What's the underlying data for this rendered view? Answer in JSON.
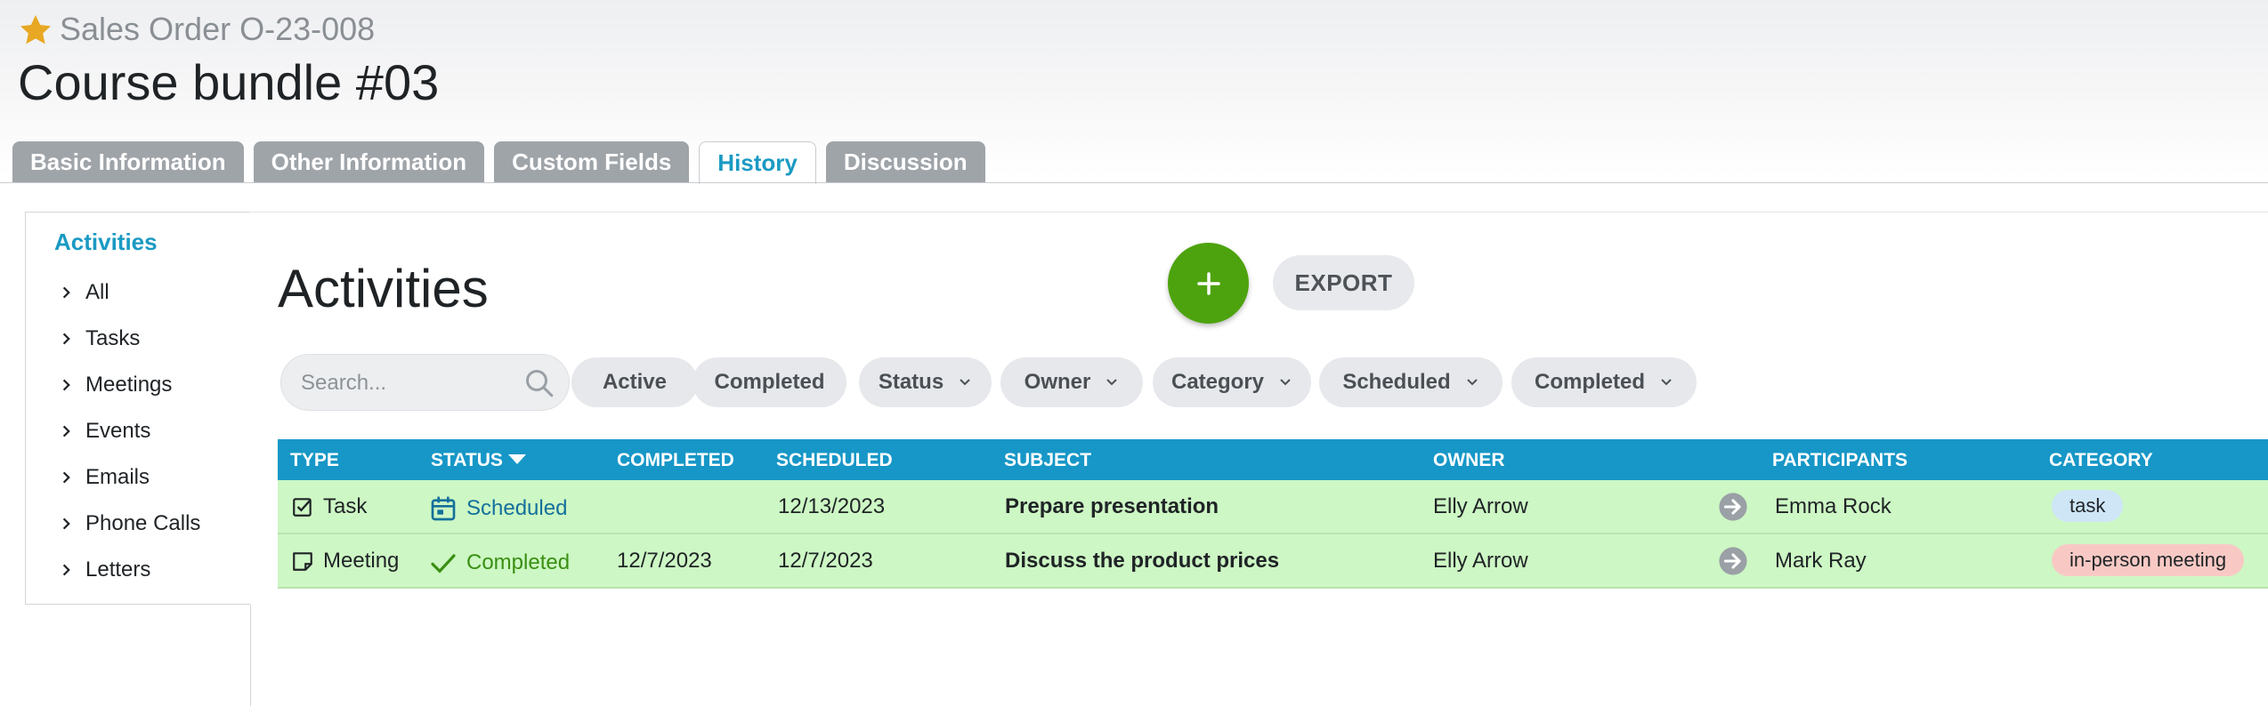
{
  "header": {
    "record_type": "Sales Order",
    "record_number": "O-23-008",
    "title": "Course bundle #03"
  },
  "tabs": [
    {
      "label": "Basic Information",
      "active": false
    },
    {
      "label": "Other Information",
      "active": false
    },
    {
      "label": "Custom Fields",
      "active": false
    },
    {
      "label": "History",
      "active": true
    },
    {
      "label": "Discussion",
      "active": false
    }
  ],
  "sidebar": {
    "title": "Activities",
    "items": [
      {
        "label": "All"
      },
      {
        "label": "Tasks"
      },
      {
        "label": "Meetings"
      },
      {
        "label": "Events"
      },
      {
        "label": "Emails"
      },
      {
        "label": "Phone Calls"
      },
      {
        "label": "Letters"
      }
    ]
  },
  "main": {
    "title": "Activities",
    "add_icon": "plus-icon",
    "export_label": "EXPORT"
  },
  "search": {
    "placeholder": "Search...",
    "value": ""
  },
  "filters": [
    {
      "label": "Active",
      "dropdown": false
    },
    {
      "label": "Completed",
      "dropdown": false
    },
    {
      "label": "Status",
      "dropdown": true
    },
    {
      "label": "Owner",
      "dropdown": true
    },
    {
      "label": "Category",
      "dropdown": true
    },
    {
      "label": "Scheduled",
      "dropdown": true
    },
    {
      "label": "Completed",
      "dropdown": true
    }
  ],
  "table": {
    "columns": [
      "TYPE",
      "STATUS",
      "COMPLETED",
      "SCHEDULED",
      "SUBJECT",
      "OWNER",
      "PARTICIPANTS",
      "CATEGORY"
    ],
    "sort_column": "STATUS",
    "rows": [
      {
        "type": "Task",
        "type_icon": "task-checkbox-icon",
        "status": "Scheduled",
        "status_icon": "calendar-icon",
        "completed": "",
        "scheduled": "12/13/2023",
        "subject": "Prepare presentation",
        "owner": "Elly Arrow",
        "participants": "Emma Rock",
        "category": "task"
      },
      {
        "type": "Meeting",
        "type_icon": "meeting-note-icon",
        "status": "Completed",
        "status_icon": "checkmark-icon",
        "completed": "12/7/2023",
        "scheduled": "12/7/2023",
        "subject": "Discuss the product prices",
        "owner": "Elly Arrow",
        "participants": "Mark Ray",
        "category": "in-person meeting"
      }
    ]
  },
  "colors": {
    "accent": "#1797c7",
    "add_button": "#4da30d",
    "row_background": "#cdf7c4",
    "star": "#e8a823",
    "status_scheduled": "#14709b",
    "status_completed": "#3a8f12",
    "category_task_bg": "#cfe6f7",
    "category_meeting_bg": "#f8c9c4"
  }
}
